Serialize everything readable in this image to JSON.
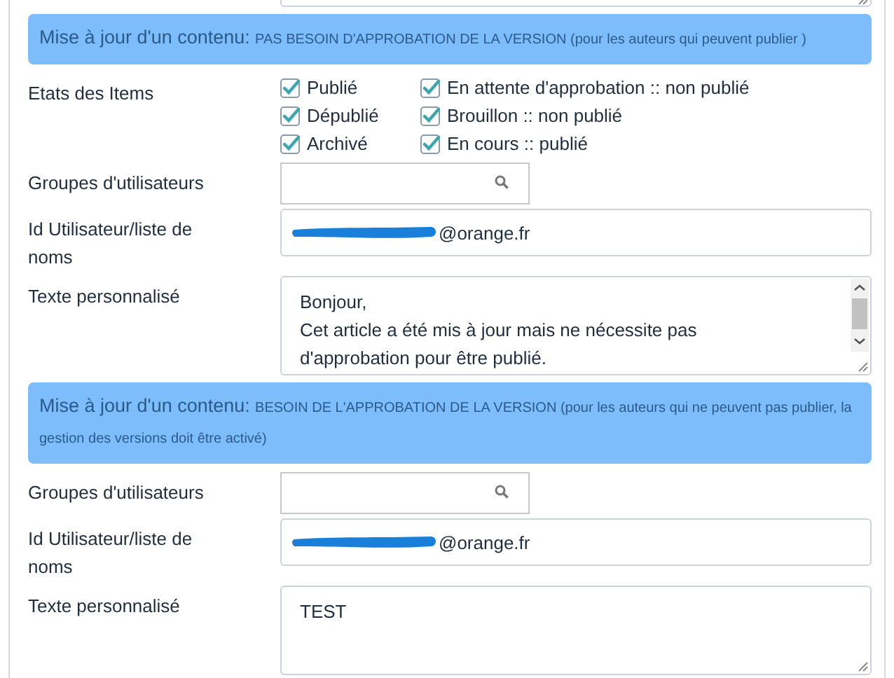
{
  "sections": [
    {
      "header": {
        "title": "Mise à jour d'un contenu:",
        "detail": "PAS BESOIN D'APPROBATION DE LA VERSION",
        "note": "(pour les auteurs qui peuvent publier )"
      },
      "fields": [
        {
          "kind": "checkboxes",
          "label": "Etats des Items",
          "options": [
            {
              "label": "Publié",
              "checked": true
            },
            {
              "label": "En attente d'approbation :: non publié",
              "checked": true
            },
            {
              "label": "Dépublié",
              "checked": true
            },
            {
              "label": "Brouillon :: non publié",
              "checked": true
            },
            {
              "label": "Archivé",
              "checked": true
            },
            {
              "label": "En cours :: publié",
              "checked": true
            }
          ]
        },
        {
          "kind": "search",
          "label": "Groupes d'utilisateurs"
        },
        {
          "kind": "text",
          "label": "Id Utilisateur/liste de noms",
          "value": "@orange.fr",
          "redacted": true
        },
        {
          "kind": "textarea",
          "label": "Texte personnalisé",
          "value": "Bonjour,\nCet article a été mis à jour mais ne nécessite pas\nd'approbation pour être publié.",
          "scrollbar": true
        }
      ]
    },
    {
      "header": {
        "title": "Mise à jour d'un contenu:",
        "detail": "BESOIN DE L'APPROBATION DE LA VERSION",
        "note": "(pour les auteurs qui ne peuvent pas publier, la gestion des versions doit être activé)"
      },
      "fields": [
        {
          "kind": "search",
          "label": "Groupes d'utilisateurs"
        },
        {
          "kind": "text",
          "label": "Id Utilisateur/liste de noms",
          "value": "@orange.fr",
          "redacted": true
        },
        {
          "kind": "textarea",
          "label": "Texte personnalisé",
          "value": "TEST",
          "scrollbar": false
        }
      ]
    }
  ]
}
